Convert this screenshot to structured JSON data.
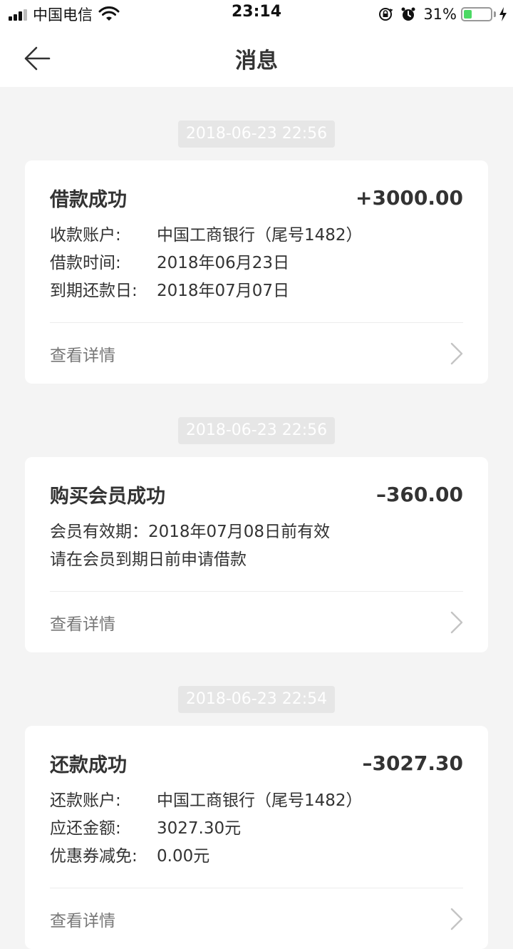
{
  "status_bar": {
    "carrier": "中国电信",
    "time": "23:14",
    "battery_percent": "31%",
    "battery_level": 0.31,
    "battery_color": "#4cd964"
  },
  "nav": {
    "title": "消息",
    "back_icon": "arrow-left-icon"
  },
  "messages": [
    {
      "timestamp": "2018-06-23 22:56",
      "title": "借款成功",
      "amount": "+3000.00",
      "rows": [
        {
          "label": "收款账户:",
          "value": "中国工商银行（尾号1482）"
        },
        {
          "label": "借款时间:",
          "value": "2018年06月23日"
        },
        {
          "label": "到期还款日:",
          "value": "2018年07月07日"
        }
      ],
      "detail_label": "查看详情"
    },
    {
      "timestamp": "2018-06-23 22:56",
      "title": "购买会员成功",
      "amount": "–360.00",
      "lines": [
        "会员有效期：2018年07月08日前有效",
        "请在会员到期日前申请借款"
      ],
      "detail_label": "查看详情"
    },
    {
      "timestamp": "2018-06-23 22:54",
      "title": "还款成功",
      "amount": "–3027.30",
      "rows": [
        {
          "label": "还款账户:",
          "value": "中国工商银行（尾号1482）"
        },
        {
          "label": "应还金额:",
          "value": "3027.30元"
        },
        {
          "label": "优惠券减免:",
          "value": "0.00元"
        }
      ],
      "detail_label": "查看详情"
    }
  ]
}
